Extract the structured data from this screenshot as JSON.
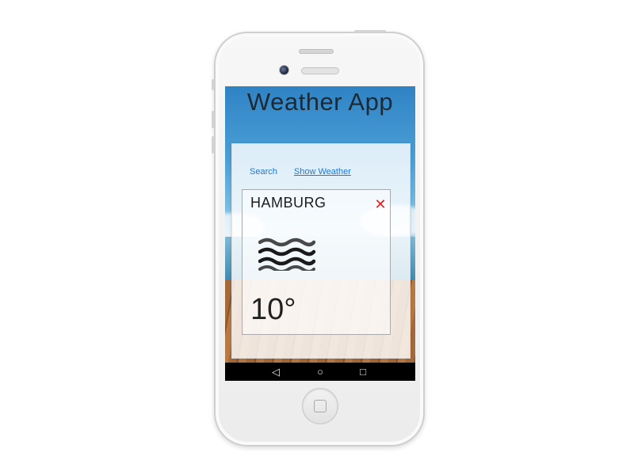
{
  "app": {
    "title": "Weather App"
  },
  "tabs": [
    {
      "label": "Search",
      "active": false
    },
    {
      "label": "Show Weather",
      "active": true
    }
  ],
  "weather_card": {
    "city": "HAMBURG",
    "temperature": "10°",
    "condition_icon": "fog-wind-icon",
    "close_icon": "close-icon"
  },
  "navbar": {
    "back_icon": "back-triangle-icon",
    "home_icon": "home-circle-icon",
    "recents_icon": "recents-square-icon",
    "back_glyph": "◁",
    "home_glyph": "○",
    "recents_glyph": "□"
  },
  "colors": {
    "link": "#1f7ad6",
    "close": "#e02020",
    "navbar": "#000000"
  }
}
